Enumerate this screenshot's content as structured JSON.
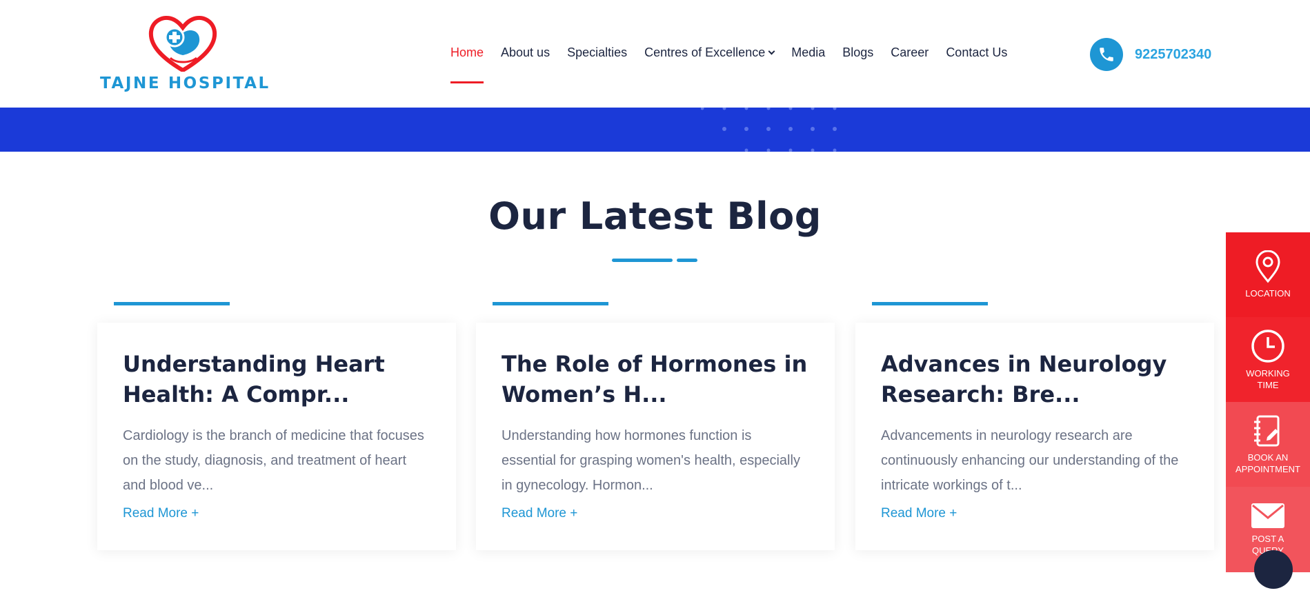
{
  "logo": {
    "text": "TAJNE HOSPITAL",
    "icon": "heart-cross-hands-logo"
  },
  "nav": {
    "items": [
      {
        "label": "Home",
        "active": true
      },
      {
        "label": "About us"
      },
      {
        "label": "Specialties"
      },
      {
        "label": "Centres of Excellence",
        "has_dropdown": true
      },
      {
        "label": "Media"
      },
      {
        "label": "Blogs"
      },
      {
        "label": "Career"
      },
      {
        "label": "Contact Us"
      }
    ]
  },
  "phone": {
    "icon": "phone-icon",
    "number": "9225702340"
  },
  "section": {
    "title": "Our Latest Blog"
  },
  "posts": [
    {
      "title": "Understanding Heart Health: A Compr...",
      "excerpt": "Cardiology is the branch of medicine that focuses on the study, diagnosis, and treatment of heart and blood ve...",
      "link": "Read More +"
    },
    {
      "title": "The Role of Hormones in Women’s H...",
      "excerpt": "Understanding how hormones function is essential for grasping women's health, especially in gynecology. Hormon...",
      "link": "Read More +"
    },
    {
      "title": "Advances in Neurology Research: Bre...",
      "excerpt": "Advancements in neurology research are continuously enhancing our understanding of the intricate workings of t...",
      "link": "Read More +"
    }
  ],
  "sidebar": [
    {
      "label": "LOCATION",
      "icon": "map-pin-icon",
      "color": "#ee1c25"
    },
    {
      "label": "WORKING\nTIME",
      "icon": "clock-icon",
      "color": "#f0232c"
    },
    {
      "label": "BOOK AN\nAPPOINTMENT",
      "icon": "notebook-pen-icon",
      "color": "#f24a52"
    },
    {
      "label": "POST A\nQUERY",
      "icon": "envelope-icon",
      "color": "#f2545c"
    }
  ],
  "colors": {
    "brand_blue": "#1e96d4",
    "band_blue": "#1b3ad8",
    "accent_red": "#ee1c25",
    "heading": "#1c2540"
  }
}
